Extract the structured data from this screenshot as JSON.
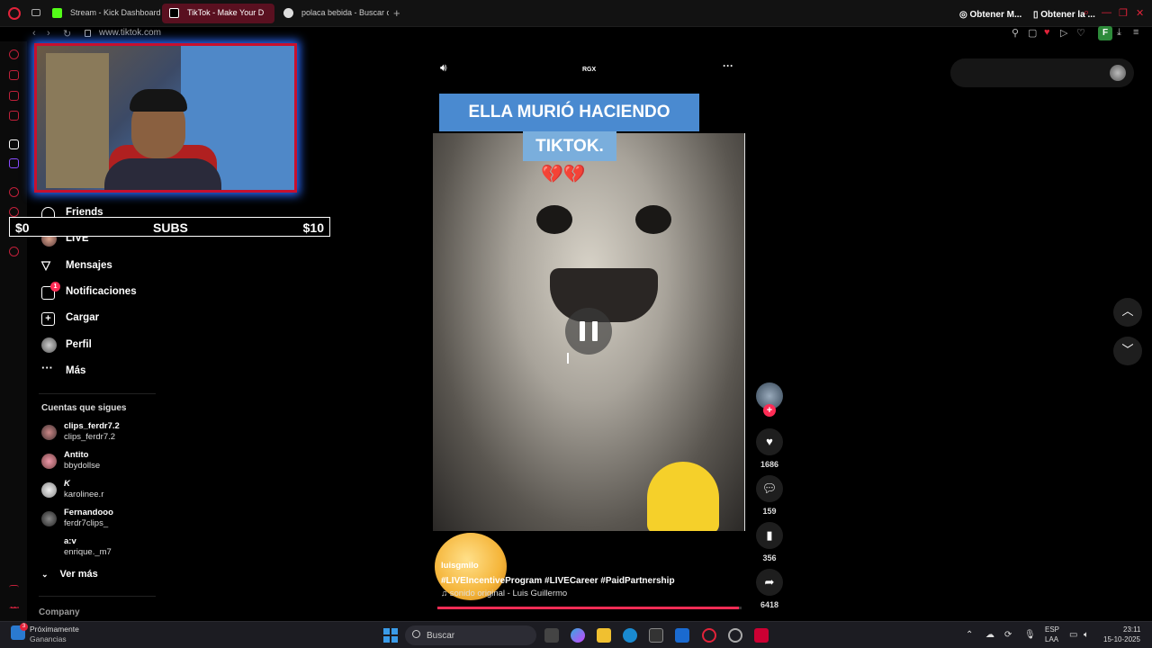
{
  "browser": {
    "tabs": [
      {
        "label": "Stream - Kick Dashboard",
        "color": "#53fc18"
      },
      {
        "label": "TikTok - Make Your D",
        "color": "#ffffff"
      },
      {
        "label": "polaca bebida - Buscar c",
        "color": "#cccccc"
      }
    ],
    "url": "www.tiktok.com",
    "profile_initial": "F",
    "accent": "#e2233a"
  },
  "stream_overlay": {
    "left_amount": "$0",
    "center_label": "SUBS",
    "right_amount": "$10"
  },
  "nav": {
    "items": [
      {
        "label": "Friends",
        "icon": "friends-icon"
      },
      {
        "label": "LIVE",
        "icon": "live-avatar"
      },
      {
        "label": "Mensajes",
        "icon": "send-icon"
      },
      {
        "label": "Notificaciones",
        "icon": "inbox-icon",
        "badge": "1"
      },
      {
        "label": "Cargar",
        "icon": "upload-icon"
      },
      {
        "label": "Perfil",
        "icon": "profile-avatar"
      },
      {
        "label": "Más",
        "icon": "more-icon"
      }
    ],
    "following_title": "Cuentas que sigues",
    "following": [
      {
        "name": "clips_ferdr7.2",
        "handle": "clips_ferdr7.2"
      },
      {
        "name": "Antito",
        "handle": "bbydollse"
      },
      {
        "name": "K",
        "handle": "karolinee.r"
      },
      {
        "name": "Fernandooo",
        "handle": "ferdr7clips_"
      },
      {
        "name": "a:v",
        "handle": "enrique._m7"
      }
    ],
    "see_more": "Ver más",
    "company": "Company"
  },
  "video": {
    "top_center_label": "RGX",
    "banner_line1": "ELLA MURIÓ HACIENDO",
    "banner_line2": "TIKTOK.",
    "hearts": "💔💔",
    "username": "luisgmilo",
    "caption": "#LIVEIncentiveProgram  #LIVECareer  #PaidPartnership",
    "sound": "♫  sonido original - Luis Guillermo",
    "progress": 0.99
  },
  "actions": {
    "likes": "1686",
    "comments": "159",
    "saves": "356",
    "shares": "6418"
  },
  "top_right": {
    "pill1": "Obtener M...",
    "pill2": "Obtener la ..."
  },
  "taskbar": {
    "weather_line1": "Próximamente",
    "weather_line2": "Ganancias",
    "weather_badge": "3",
    "search": "Buscar",
    "lang1": "ESP",
    "lang2": "LAA",
    "time": "23:11",
    "date": "15-10-2025"
  }
}
